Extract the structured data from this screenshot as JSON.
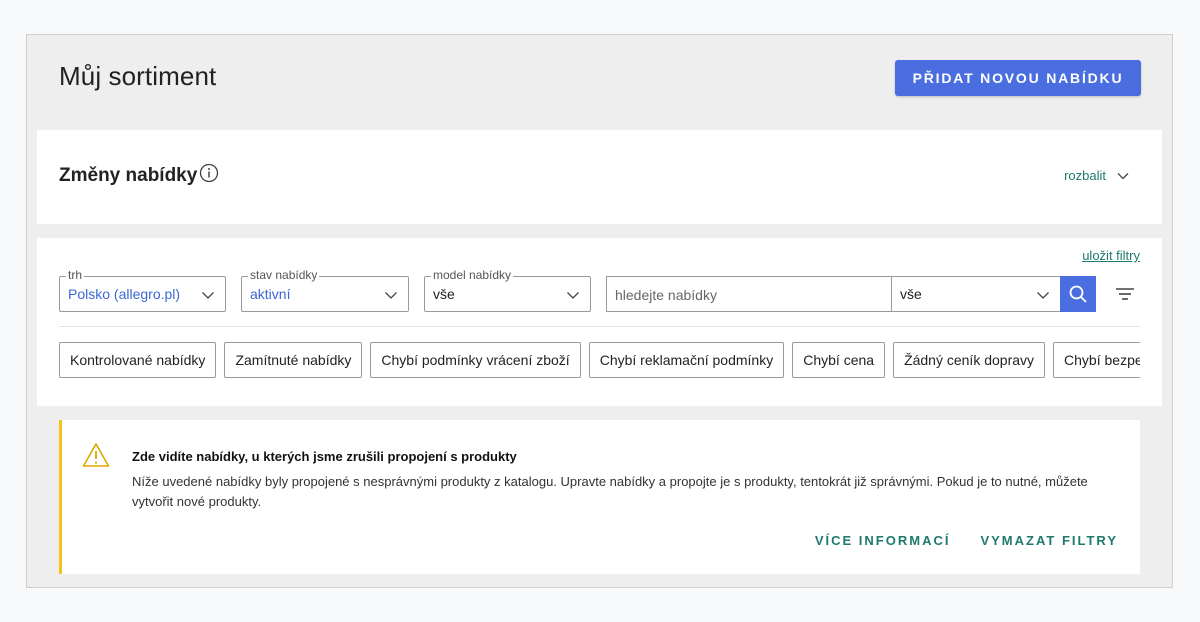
{
  "header": {
    "title": "Můj sortiment",
    "add_button": "PŘIDAT NOVOU NABÍDKU"
  },
  "changes": {
    "title": "Změny nabídky",
    "expand_label": "rozbalit"
  },
  "filters": {
    "save_label": "uložit filtry",
    "market": {
      "label": "trh",
      "value": "Polsko (allegro.pl)"
    },
    "status": {
      "label": "stav nabídky",
      "value": "aktivní"
    },
    "model": {
      "label": "model nabídky",
      "value": "vše"
    },
    "search": {
      "placeholder": "hledejte nabídky",
      "scope": "vše"
    },
    "chips": [
      "Kontrolované nabídky",
      "Zamítnuté nabídky",
      "Chybí podmínky vrácení zboží",
      "Chybí reklamační podmínky",
      "Chybí cena",
      "Žádný ceník dopravy",
      "Chybí bezpečnostní info"
    ]
  },
  "alert": {
    "title": "Zde vidíte nabídky, u kterých jsme zrušili propojení s produkty",
    "text": "Níže uvedené nabídky byly propojené s nesprávnými produkty z katalogu. Upravte nabídky a propojte je s produkty, tentokrát již správnými. Pokud je to nutné, můžete vytvořit nové produkty.",
    "more_info": "VÍCE INFORMACÍ",
    "clear_filters": "VYMAZAT FILTRY"
  },
  "colors": {
    "accent": "#4a6ee0",
    "link": "#1e7a6e",
    "warning": "#f2c417",
    "selected_value": "#3b67d6"
  }
}
